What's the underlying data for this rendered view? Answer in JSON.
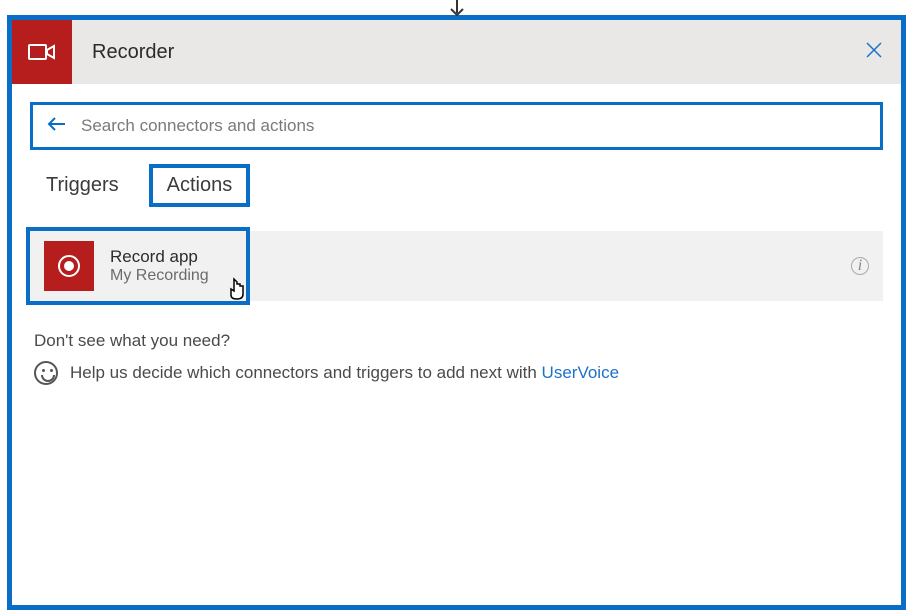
{
  "header": {
    "title": "Recorder"
  },
  "search": {
    "placeholder": "Search connectors and actions"
  },
  "tabs": {
    "triggers": "Triggers",
    "actions": "Actions"
  },
  "actions": [
    {
      "title": "Record app",
      "subtitle": "My Recording"
    }
  ],
  "footer": {
    "heading": "Don't see what you need?",
    "help_text": "Help us decide which connectors and triggers to add next with ",
    "link_text": "UserVoice"
  }
}
